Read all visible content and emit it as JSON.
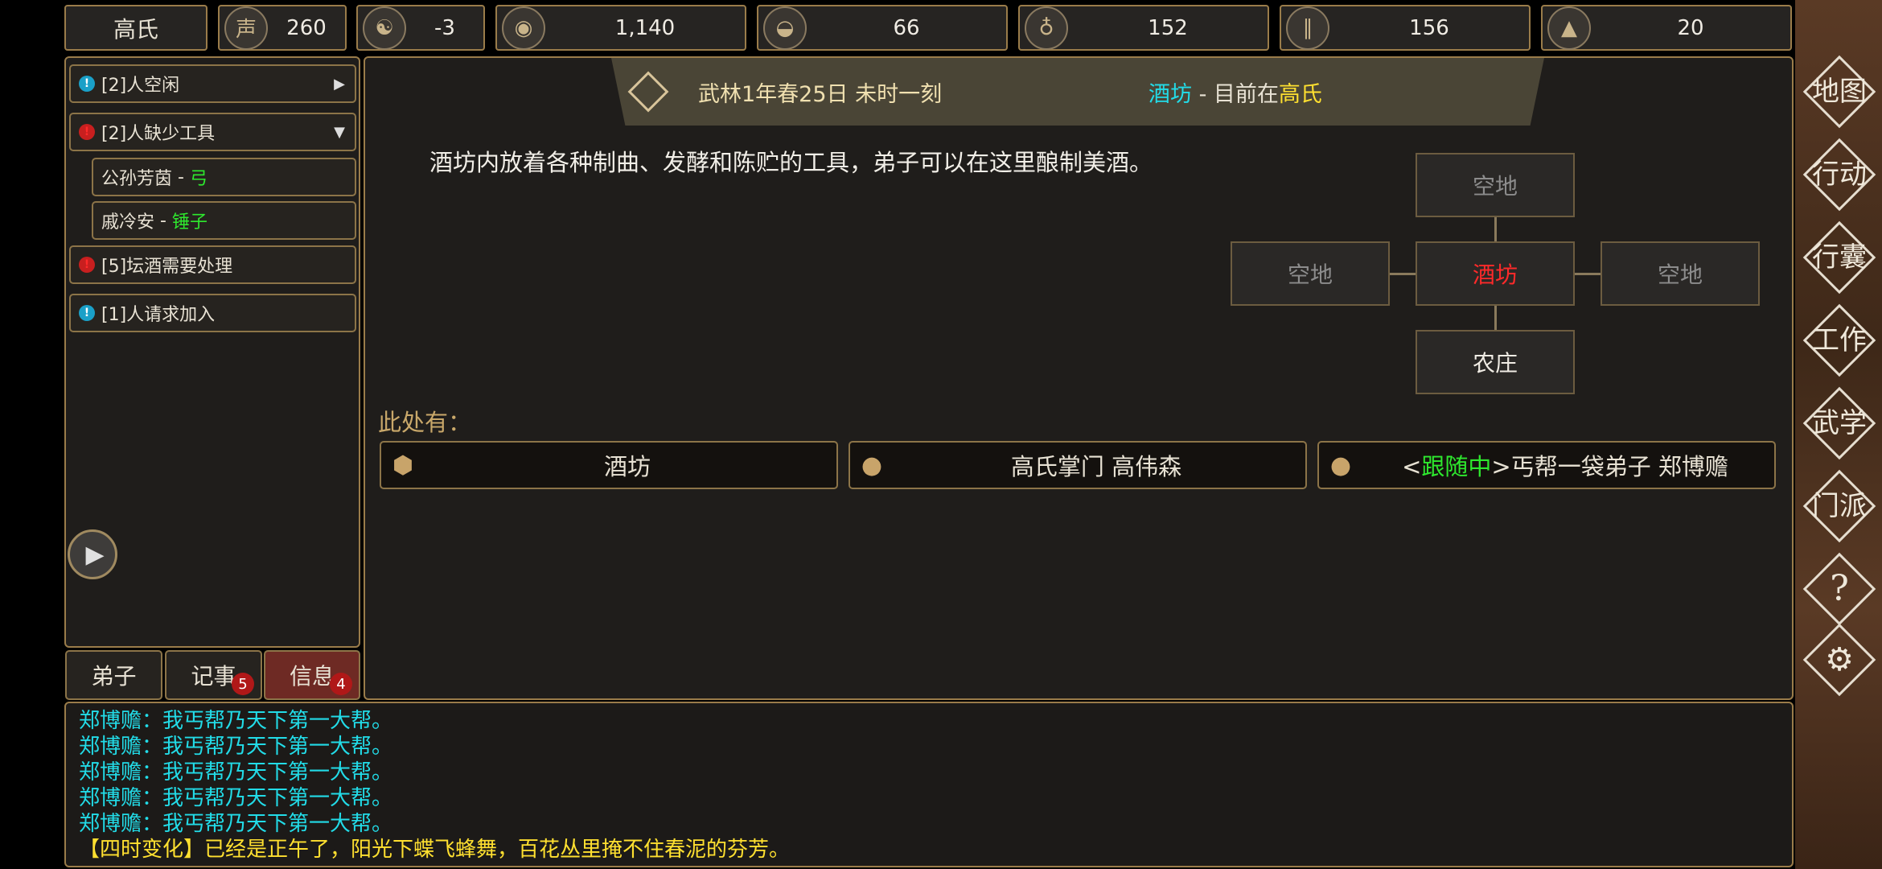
{
  "topbar": {
    "sect_name": "高氏",
    "resources": [
      {
        "icon": "prestige-icon",
        "glyph": "声",
        "value": "260"
      },
      {
        "icon": "yin-yang-icon",
        "glyph": "☯",
        "value": "-3"
      },
      {
        "icon": "coin-icon",
        "glyph": "◉",
        "value": "1,140"
      },
      {
        "icon": "food-bowl-icon",
        "glyph": "◒",
        "value": "66"
      },
      {
        "icon": "wine-gourd-icon",
        "glyph": "♁",
        "value": "152"
      },
      {
        "icon": "wood-icon",
        "glyph": "∥",
        "value": "156"
      },
      {
        "icon": "ore-icon",
        "glyph": "▲",
        "value": "20"
      }
    ]
  },
  "alerts": [
    {
      "text": "[2]人空闲"
    },
    {
      "text": "[2]人缺少工具"
    },
    {
      "text": "[5]坛酒需要处理"
    },
    {
      "text": "[1]人请求加入"
    }
  ],
  "tool_needs": [
    {
      "name": "公孙芳茵",
      "sep": " - ",
      "tool": "弓"
    },
    {
      "name": "戚冷安",
      "sep": " - ",
      "tool": "锤子"
    }
  ],
  "tabs": [
    {
      "label": "弟子"
    },
    {
      "label": "记事",
      "badge": "5"
    },
    {
      "label": "信息",
      "badge": "4"
    }
  ],
  "header": {
    "date": "武林1年春25日 未时一刻",
    "location": "酒坊",
    "sep": " - ",
    "prefix": "目前在",
    "sect": "高氏"
  },
  "description": "酒坊内放着各种制曲、发酵和陈贮的工具，弟子可以在这里酿制美酒。",
  "map": {
    "north": "空地",
    "west": "空地",
    "center": "酒坊",
    "east": "空地",
    "south": "农庄"
  },
  "here_label": "此处有：",
  "entities": [
    {
      "icon": "box-icon",
      "text": "酒坊"
    },
    {
      "icon": "person-icon",
      "text": "高氏掌门 高伟森"
    },
    {
      "icon": "person-icon",
      "pre": "<",
      "status": "跟随中",
      "post": ">丐帮一袋弟子 郑博赡"
    }
  ],
  "log": [
    "郑博赡：我丐帮乃天下第一大帮。",
    "郑博赡：我丐帮乃天下第一大帮。",
    "郑博赡：我丐帮乃天下第一大帮。",
    "郑博赡：我丐帮乃天下第一大帮。",
    "郑博赡：我丐帮乃天下第一大帮。",
    "【四时变化】已经是正午了，阳光下蝶飞蜂舞，百花丛里掩不住春泥的芬芳。"
  ],
  "right_menu": [
    {
      "label": "地图"
    },
    {
      "label": "行动"
    },
    {
      "label": "行囊"
    },
    {
      "label": "工作"
    },
    {
      "label": "武学"
    },
    {
      "label": "门派"
    },
    {
      "label": "?"
    },
    {
      "label": "⚙"
    }
  ],
  "colors": {
    "frame": "#9a7c4a",
    "panel": "#1f1d1b",
    "right_bg": "#4a3020",
    "highlight_cyan": "#22dce8",
    "highlight_yellow": "#ffe030",
    "highlight_green": "#2ee82e",
    "highlight_red": "#ff2a2a"
  }
}
